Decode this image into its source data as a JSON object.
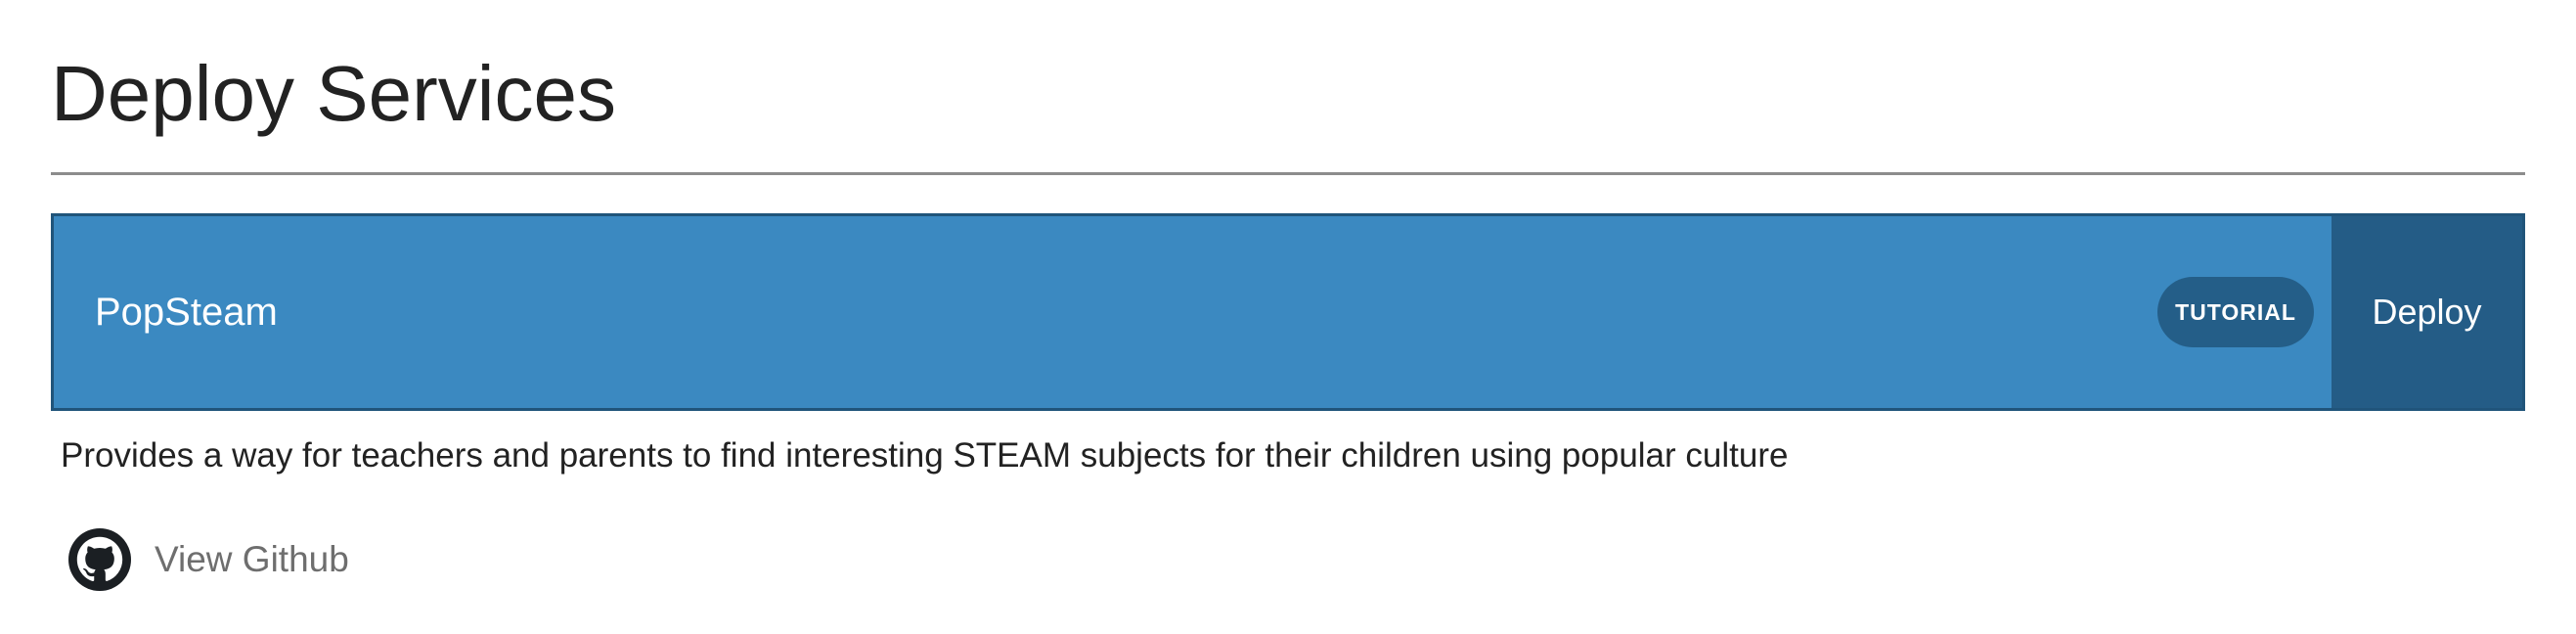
{
  "page": {
    "title": "Deploy Services"
  },
  "service": {
    "name": "PopSteam",
    "badge_label": "TUTORIAL",
    "deploy_label": "Deploy",
    "description": "Provides a way for teachers and parents to find interesting STEAM subjects for their children using popular culture",
    "github": {
      "icon": "github-icon",
      "label": "View Github"
    }
  },
  "colors": {
    "card_background": "#3b89c1",
    "card_border": "#20547a",
    "deploy_background": "#245c86",
    "badge_background": "#245e88",
    "link_text": "#6e6e6e"
  }
}
